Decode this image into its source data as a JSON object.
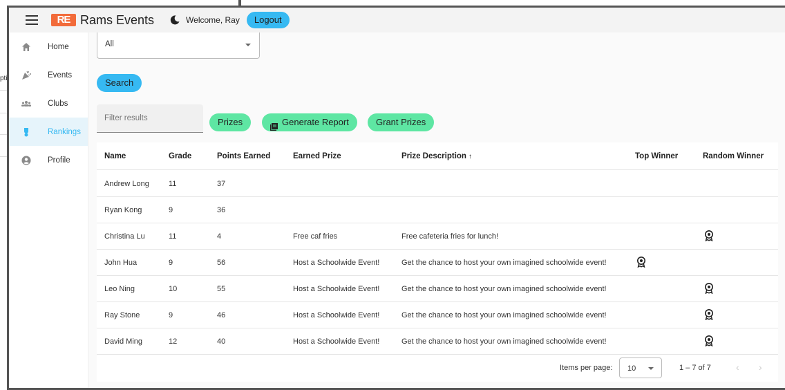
{
  "background": {
    "fragment_text": "pti"
  },
  "header": {
    "logo_text": "RE",
    "title": "Rams Events",
    "welcome": "Welcome, Ray",
    "logout_label": "Logout",
    "theme_icon": "moon-icon",
    "accent_color": "#36b9f2"
  },
  "sidebar": {
    "items": [
      {
        "label": "Home",
        "icon": "home-icon",
        "active": false
      },
      {
        "label": "Events",
        "icon": "party-icon",
        "active": false
      },
      {
        "label": "Clubs",
        "icon": "groups-icon",
        "active": false
      },
      {
        "label": "Rankings",
        "icon": "trophy-icon",
        "active": true
      },
      {
        "label": "Profile",
        "icon": "account-icon",
        "active": false
      }
    ]
  },
  "filters": {
    "grade_select_value": "All",
    "search_label": "Search",
    "filter_placeholder": "Filter results"
  },
  "actions": {
    "prizes_label": "Prizes",
    "generate_report_label": "Generate Report",
    "grant_prizes_label": "Grant Prizes",
    "button_color": "#5ee6a3"
  },
  "table": {
    "columns": [
      "Name",
      "Grade",
      "Points Earned",
      "Earned Prize",
      "Prize Description",
      "Top Winner",
      "Random Winner"
    ],
    "sort_indicator": "↑",
    "rows": [
      {
        "name": "Andrew Long",
        "grade": "11",
        "points": "37",
        "prize": "",
        "description": "",
        "top_winner": false,
        "random_winner": false
      },
      {
        "name": "Ryan Kong",
        "grade": "9",
        "points": "36",
        "prize": "",
        "description": "",
        "top_winner": false,
        "random_winner": false
      },
      {
        "name": "Christina Lu",
        "grade": "11",
        "points": "4",
        "prize": "Free caf fries",
        "description": "Free cafeteria fries for lunch!",
        "top_winner": false,
        "random_winner": true
      },
      {
        "name": "John Hua",
        "grade": "9",
        "points": "56",
        "prize": "Host a Schoolwide Event!",
        "description": "Get the chance to host your own imagined schoolwide event!",
        "top_winner": true,
        "random_winner": false
      },
      {
        "name": "Leo Ning",
        "grade": "10",
        "points": "55",
        "prize": "Host a Schoolwide Event!",
        "description": "Get the chance to host your own imagined schoolwide event!",
        "top_winner": false,
        "random_winner": true
      },
      {
        "name": "Ray Stone",
        "grade": "9",
        "points": "46",
        "prize": "Host a Schoolwide Event!",
        "description": "Get the chance to host your own imagined schoolwide event!",
        "top_winner": false,
        "random_winner": true
      },
      {
        "name": "David Ming",
        "grade": "12",
        "points": "40",
        "prize": "Host a Schoolwide Event!",
        "description": "Get the chance to host your own imagined schoolwide event!",
        "top_winner": false,
        "random_winner": true
      }
    ]
  },
  "paginator": {
    "items_per_page_label": "Items per page:",
    "items_per_page_value": "10",
    "range_label": "1 – 7 of 7",
    "prev_icon": "chevron-left-icon",
    "next_icon": "chevron-right-icon"
  }
}
